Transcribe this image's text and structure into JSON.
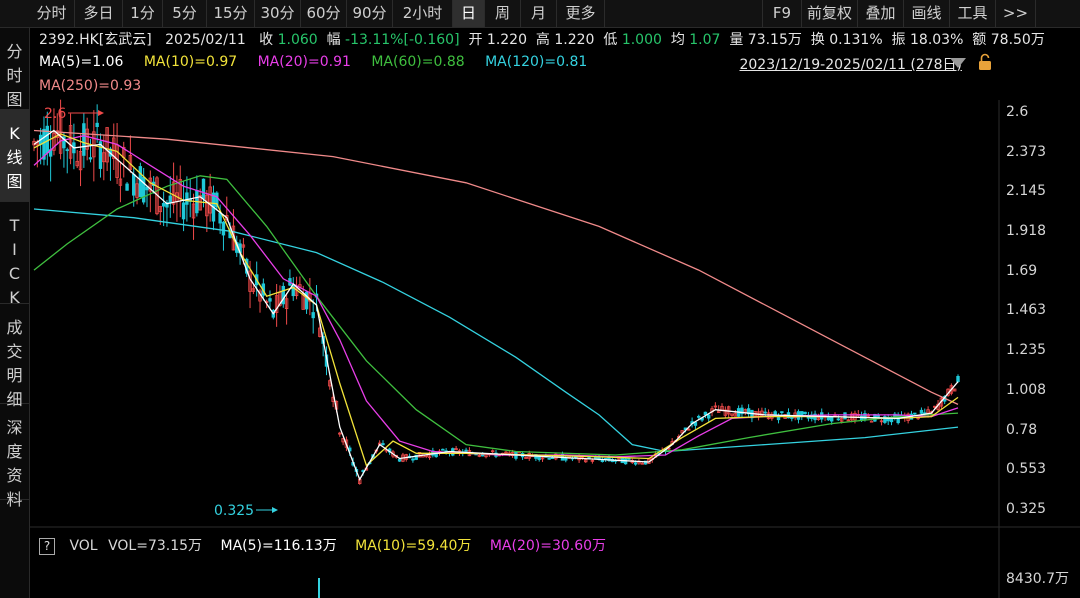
{
  "toolbar": {
    "tabs": [
      "分时",
      "多日",
      "1分",
      "5分",
      "15分",
      "30分",
      "60分",
      "90分",
      "2小时",
      "日",
      "周",
      "月",
      "更多"
    ],
    "active": "日",
    "right": [
      "F9",
      "前复权",
      "叠加",
      "画线",
      "工具",
      ">>"
    ]
  },
  "sidebar": {
    "items": [
      "分时图",
      "K线图",
      "TICK",
      "成交明细",
      "深度资料"
    ],
    "active": "K线图"
  },
  "info": {
    "code": "2392.HK[玄武云]",
    "date": "2025/02/11",
    "close_label": "收",
    "close": "1.060",
    "amp_label": "幅",
    "amp": "-13.11%[-0.160]",
    "open_label": "开",
    "open": "1.220",
    "high_label": "高",
    "high": "1.220",
    "low_label": "低",
    "low": "1.000",
    "avg_label": "均",
    "avg": "1.07",
    "vol_label": "量",
    "vol": "73.15万",
    "turnover_label": "换",
    "turnover": "0.131%",
    "swing_label": "振",
    "swing": "18.03%",
    "amount_label": "额",
    "amount": "78.50万"
  },
  "ma": {
    "ma5": "MA(5)=1.06",
    "ma10": "MA(10)=0.97",
    "ma20": "MA(20)=0.91",
    "ma60": "MA(60)=0.88",
    "ma120": "MA(120)=0.81",
    "ma250": "MA(250)=0.93"
  },
  "range_text": "2023/12/19-2025/02/11 (278日)",
  "vol_panel": {
    "help": "?",
    "label": "VOL",
    "vol": "VOL=73.15万",
    "ma5": "MA(5)=116.13万",
    "ma10": "MA(10)=59.40万",
    "ma20": "MA(20)=30.60万",
    "max_label": "8430.7万"
  },
  "colors": {
    "up": "#f04a4a",
    "down": "#1fc8d8",
    "ma5": "#ffffff",
    "ma10": "#f2e33a",
    "ma20": "#e83ee8",
    "ma60": "#3fbf3f",
    "ma120": "#34d2e0",
    "ma250": "#f08a8a"
  },
  "chart_data": {
    "type": "line",
    "title": "",
    "y_ticks": [
      "2.6",
      "2.373",
      "2.145",
      "1.918",
      "1.69",
      "1.463",
      "1.235",
      "1.008",
      "0.78",
      "0.553",
      "0.325"
    ],
    "ylim": [
      0.325,
      2.6
    ],
    "annotations": [
      {
        "text": "2.6",
        "kind": "high"
      },
      {
        "text": "0.325",
        "kind": "low"
      }
    ],
    "series": [
      {
        "name": "MA(250)",
        "color": "#f08a8a",
        "values": [
          [
            0,
            2.5
          ],
          [
            40,
            2.45
          ],
          [
            90,
            2.35
          ],
          [
            130,
            2.2
          ],
          [
            170,
            1.95
          ],
          [
            200,
            1.7
          ],
          [
            225,
            1.45
          ],
          [
            240,
            1.3
          ],
          [
            250,
            1.2
          ],
          [
            260,
            1.1
          ],
          [
            270,
            1.0
          ],
          [
            278,
            0.93
          ]
        ]
      },
      {
        "name": "MA(120)",
        "color": "#34d2e0",
        "values": [
          [
            0,
            2.05
          ],
          [
            30,
            2.0
          ],
          [
            60,
            1.92
          ],
          [
            85,
            1.8
          ],
          [
            105,
            1.63
          ],
          [
            125,
            1.43
          ],
          [
            145,
            1.2
          ],
          [
            160,
            1.0
          ],
          [
            170,
            0.87
          ],
          [
            180,
            0.7
          ],
          [
            190,
            0.66
          ],
          [
            220,
            0.7
          ],
          [
            250,
            0.74
          ],
          [
            278,
            0.8
          ]
        ]
      },
      {
        "name": "MA(60)",
        "color": "#3fbf3f",
        "values": [
          [
            0,
            1.7
          ],
          [
            10,
            1.85
          ],
          [
            25,
            2.05
          ],
          [
            40,
            2.18
          ],
          [
            50,
            2.24
          ],
          [
            58,
            2.22
          ],
          [
            70,
            1.95
          ],
          [
            85,
            1.55
          ],
          [
            100,
            1.18
          ],
          [
            115,
            0.9
          ],
          [
            130,
            0.7
          ],
          [
            145,
            0.66
          ],
          [
            175,
            0.64
          ],
          [
            195,
            0.67
          ],
          [
            215,
            0.74
          ],
          [
            240,
            0.82
          ],
          [
            260,
            0.86
          ],
          [
            278,
            0.88
          ]
        ]
      },
      {
        "name": "MA(20)",
        "color": "#e83ee8",
        "values": [
          [
            0,
            2.3
          ],
          [
            8,
            2.44
          ],
          [
            15,
            2.47
          ],
          [
            25,
            2.42
          ],
          [
            35,
            2.3
          ],
          [
            45,
            2.18
          ],
          [
            55,
            2.12
          ],
          [
            65,
            1.9
          ],
          [
            75,
            1.65
          ],
          [
            85,
            1.55
          ],
          [
            92,
            1.3
          ],
          [
            100,
            0.95
          ],
          [
            110,
            0.72
          ],
          [
            120,
            0.66
          ],
          [
            140,
            0.64
          ],
          [
            160,
            0.64
          ],
          [
            175,
            0.63
          ],
          [
            190,
            0.64
          ],
          [
            200,
            0.75
          ],
          [
            210,
            0.85
          ],
          [
            220,
            0.86
          ],
          [
            240,
            0.87
          ],
          [
            260,
            0.87
          ],
          [
            270,
            0.86
          ],
          [
            278,
            0.91
          ]
        ]
      },
      {
        "name": "MA(10)",
        "color": "#f2e33a",
        "values": [
          [
            0,
            2.4
          ],
          [
            8,
            2.48
          ],
          [
            15,
            2.43
          ],
          [
            25,
            2.38
          ],
          [
            35,
            2.2
          ],
          [
            45,
            2.1
          ],
          [
            55,
            2.08
          ],
          [
            62,
            1.8
          ],
          [
            70,
            1.55
          ],
          [
            78,
            1.6
          ],
          [
            85,
            1.5
          ],
          [
            92,
            1.05
          ],
          [
            100,
            0.58
          ],
          [
            108,
            0.72
          ],
          [
            115,
            0.65
          ],
          [
            130,
            0.65
          ],
          [
            150,
            0.64
          ],
          [
            170,
            0.63
          ],
          [
            185,
            0.62
          ],
          [
            195,
            0.74
          ],
          [
            205,
            0.85
          ],
          [
            220,
            0.86
          ],
          [
            240,
            0.86
          ],
          [
            260,
            0.85
          ],
          [
            270,
            0.86
          ],
          [
            278,
            0.97
          ]
        ]
      },
      {
        "name": "MA(5)",
        "color": "#ffffff",
        "values": [
          [
            0,
            2.42
          ],
          [
            6,
            2.5
          ],
          [
            12,
            2.4
          ],
          [
            20,
            2.42
          ],
          [
            30,
            2.25
          ],
          [
            40,
            2.08
          ],
          [
            50,
            2.12
          ],
          [
            58,
            2.0
          ],
          [
            65,
            1.65
          ],
          [
            72,
            1.45
          ],
          [
            78,
            1.62
          ],
          [
            85,
            1.5
          ],
          [
            92,
            0.8
          ],
          [
            98,
            0.5
          ],
          [
            104,
            0.7
          ],
          [
            110,
            0.62
          ],
          [
            125,
            0.66
          ],
          [
            145,
            0.64
          ],
          [
            165,
            0.62
          ],
          [
            185,
            0.6
          ],
          [
            192,
            0.7
          ],
          [
            198,
            0.82
          ],
          [
            205,
            0.9
          ],
          [
            220,
            0.87
          ],
          [
            240,
            0.86
          ],
          [
            260,
            0.85
          ],
          [
            270,
            0.88
          ],
          [
            278,
            1.06
          ]
        ]
      }
    ]
  }
}
